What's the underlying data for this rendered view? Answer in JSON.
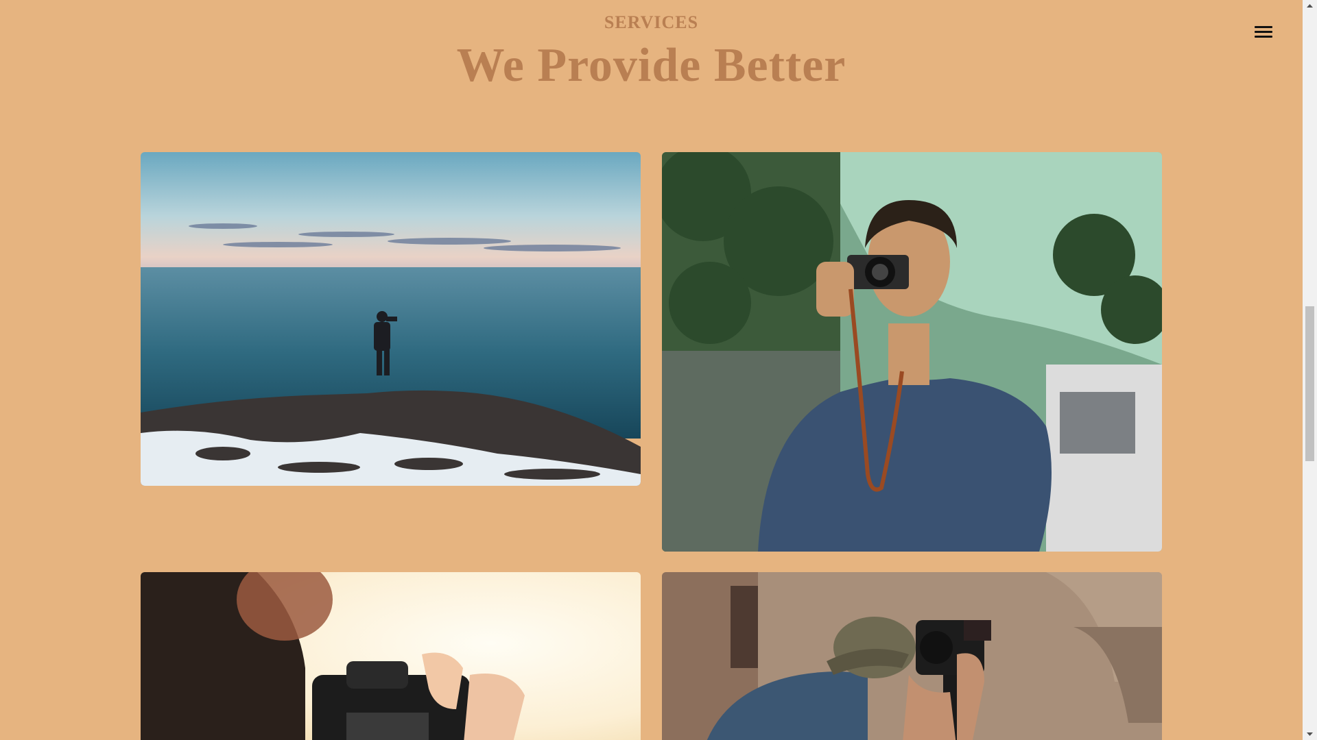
{
  "section": {
    "eyebrow": "SERVICES",
    "headline": "We Provide Better"
  },
  "header": {
    "menu_icon": "hamburger-menu-icon"
  },
  "gallery": {
    "items": [
      {
        "image": "photographer-on-sea-cliff-at-dusk"
      },
      {
        "image": "young-man-holding-camera-to-eye"
      },
      {
        "image": "camera-held-up-to-bright-sunset"
      },
      {
        "image": "man-in-cap-shooting-with-camera"
      }
    ]
  },
  "colors": {
    "background": "#e6b480",
    "heading": "#b97f52"
  }
}
